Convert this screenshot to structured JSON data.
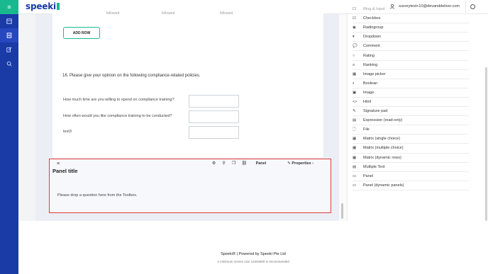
{
  "brand": {
    "name": "speeki",
    "accent": "#19b98f",
    "nav_color": "#1a3aa6"
  },
  "header": {
    "user_email": "surveytest+10@devanddeliver.com"
  },
  "sidebar": {
    "icons": [
      "menu-icon",
      "dashboard-icon",
      "list-icon",
      "edit-icon",
      "search-icon"
    ]
  },
  "matrix_cut": [
    "followed",
    "followed",
    "followed"
  ],
  "add_row_label": "ADD ROW",
  "question16": {
    "title": "16.   Please give your opinion on the following compliance-related policies.",
    "rows": [
      "How much time are you willing to spend on compliance training?",
      "How often would you like compliance training to be conducted?",
      "text3"
    ]
  },
  "panel": {
    "title": "Panel title",
    "drop_hint": "Please drop a question here from the Toolbox.",
    "type_label": "Panel",
    "properties_label": "Properties"
  },
  "toolbox": {
    "partial_top": "Ring & Input",
    "items": [
      {
        "icon": "☑",
        "label": "Checkbox"
      },
      {
        "icon": "◉",
        "label": "Radiogroup"
      },
      {
        "icon": "▾",
        "label": "Dropdown"
      },
      {
        "icon": "💬",
        "label": "Comment"
      },
      {
        "icon": "○",
        "label": "Rating"
      },
      {
        "icon": "≡",
        "label": "Ranking"
      },
      {
        "icon": "▦",
        "label": "Image picker"
      },
      {
        "icon": "◐",
        "label": "Boolean"
      },
      {
        "icon": "▣",
        "label": "Image"
      },
      {
        "icon": "<>",
        "label": "Html"
      },
      {
        "icon": "✎",
        "label": "Signature pad"
      },
      {
        "icon": "▤",
        "label": "Expression (read-only)"
      },
      {
        "icon": "🗋",
        "label": "File"
      },
      {
        "icon": "▦",
        "label": "Matrix (single choice)"
      },
      {
        "icon": "▦",
        "label": "Matrix (multiple choice)"
      },
      {
        "icon": "▦",
        "label": "Matrix (dynamic rows)"
      },
      {
        "icon": "▤",
        "label": "Multiple Text"
      },
      {
        "icon": "▭",
        "label": "Panel"
      },
      {
        "icon": "▭",
        "label": "Panel (dynamic panels)"
      }
    ]
  },
  "footer": {
    "line1": "Speeki® | Powered by Speeki Pte Ltd",
    "line2": "A minimum screen size 1440x900 is recommended"
  }
}
